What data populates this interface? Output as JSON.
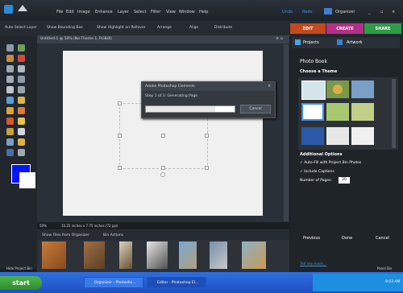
{
  "menu": {
    "items": [
      "File",
      "Edit",
      "Image",
      "Enhance",
      "Layer",
      "Select",
      "Filter",
      "View",
      "Window",
      "Help"
    ],
    "undo_label": "Undo",
    "redo_label": "Redo",
    "organizer_label": "Organizer"
  },
  "options_bar": {
    "auto_select": "Auto Select Layer",
    "bounding_box": "Show Bounding Box",
    "highlight": "Show Highlight on Rollover",
    "arrange": "Arrange",
    "align": "Align",
    "distribute": "Distribute"
  },
  "modes": {
    "edit": "EDIT",
    "create": "CREATE",
    "share": "SHARE"
  },
  "document": {
    "tab_title": "Untitled-1 @ 50% (No Theme 1, RGB/8)",
    "zoom": "50%",
    "dimensions": "10.25 inches x 7.75 inches (72 ppi)"
  },
  "dialog": {
    "title": "Adobe Photoshop Elements",
    "step": "Step 1 of 3: Generating Page",
    "progress": 0.78,
    "cancel": "Cancel"
  },
  "bin": {
    "show_files": "Show Files from Organizer",
    "actions": "Bin Actions"
  },
  "panel": {
    "tab_projects": "Projects",
    "tab_artwork": "Artwork",
    "heading": "Photo Book",
    "choose_theme": "Choose a Theme",
    "additional": "Additional Options",
    "autofill": "Auto-Fill with Project Bin Photos",
    "captions": "Include Captions",
    "pages_label": "Number of Pages:",
    "pages_value": "20",
    "previous": "Previous",
    "done": "Done",
    "cancel": "Cancel",
    "tell_more": "Tell me more..."
  },
  "footer": {
    "hide_project_bin": "Hide Project Bin",
    "panel_bin": "Panel Bin"
  },
  "taskbar": {
    "start": "start",
    "task1": "Organizer - Photosho...",
    "task2": "Editor - Photoshop El...",
    "clock": "9:03 AM"
  },
  "colors": {
    "edit_tab": "#c24a1e",
    "create_tab": "#b52f86",
    "share_tab": "#2f9c48",
    "foreground_color": "#0015ff"
  }
}
